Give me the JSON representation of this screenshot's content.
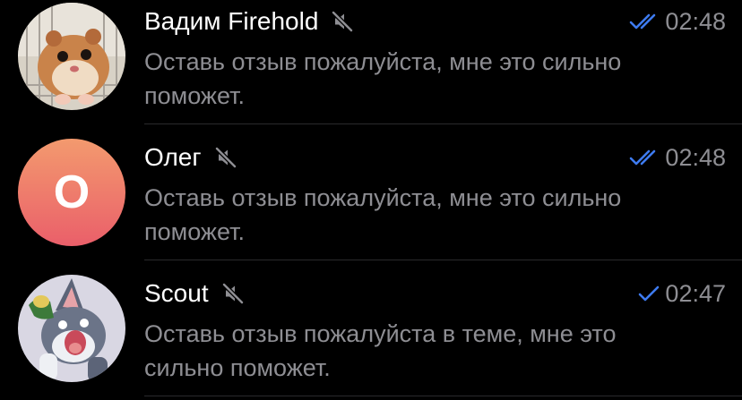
{
  "colors": {
    "background": "#000000",
    "name_text": "#ffffff",
    "secondary_text": "#8e8e93",
    "read_check": "#3e7bf0",
    "divider": "#2a2a2c",
    "avatar_gradient_top": "#f39a6e",
    "avatar_gradient_bottom": "#ea5f6a"
  },
  "chats": [
    {
      "name": "Вадим Firehold",
      "muted": true,
      "status_icon": "double-check-icon",
      "time": "02:48",
      "message": "Оставь отзыв пожалуйста, мне это сильно поможет.",
      "avatar": "hamster-photo"
    },
    {
      "name": "Олег",
      "muted": true,
      "status_icon": "double-check-icon",
      "time": "02:48",
      "message": "Оставь отзыв пожалуйста, мне это сильно поможет.",
      "avatar_letter": "О"
    },
    {
      "name": "Scout",
      "muted": true,
      "status_icon": "single-check-icon",
      "time": "02:47",
      "message": "Оставь отзыв пожалуйста в теме, мне это сильно поможет.",
      "avatar": "cartoon-cat-photo"
    }
  ]
}
